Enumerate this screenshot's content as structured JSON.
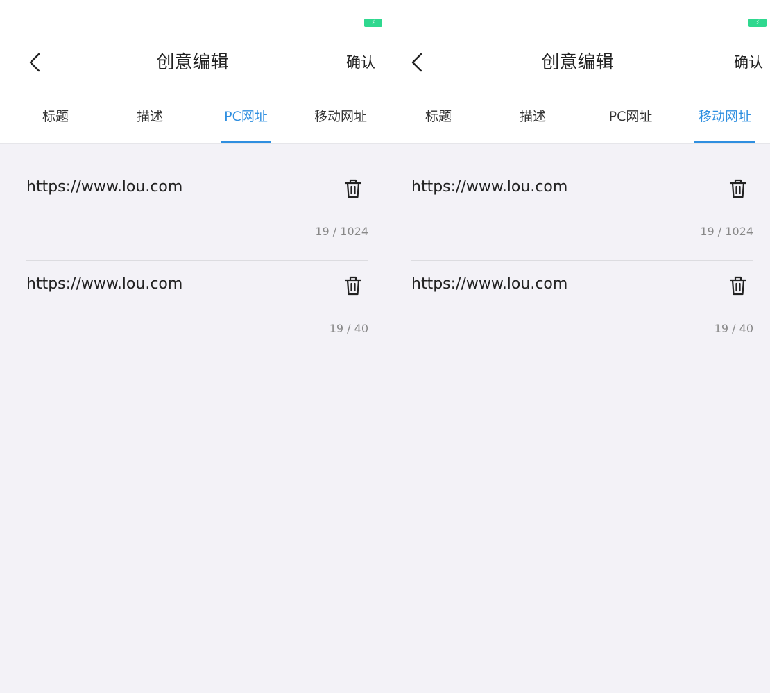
{
  "screens": [
    {
      "nav": {
        "title": "创意编辑",
        "confirm_label": "确认"
      },
      "tabs": [
        {
          "label": "标题",
          "active": false
        },
        {
          "label": "描述",
          "active": false
        },
        {
          "label": "PC网址",
          "active": true
        },
        {
          "label": "移动网址",
          "active": false
        }
      ],
      "items": [
        {
          "url": "https://www.lou.com",
          "counter": "19 / 1024"
        },
        {
          "url": "https://www.lou.com",
          "counter": "19 / 40"
        }
      ]
    },
    {
      "nav": {
        "title": "创意编辑",
        "confirm_label": "确认"
      },
      "tabs": [
        {
          "label": "标题",
          "active": false
        },
        {
          "label": "描述",
          "active": false
        },
        {
          "label": "PC网址",
          "active": false
        },
        {
          "label": "移动网址",
          "active": true
        }
      ],
      "items": [
        {
          "url": "https://www.lou.com",
          "counter": "19 / 1024"
        },
        {
          "url": "https://www.lou.com",
          "counter": "19 / 40"
        }
      ]
    }
  ],
  "icons": {
    "back": "chevron-left-icon",
    "delete": "trash-icon",
    "battery": "battery-charging-icon"
  },
  "colors": {
    "accent": "#2f8fe0",
    "battery": "#2fd88f",
    "content_bg": "#f3f2f7"
  }
}
